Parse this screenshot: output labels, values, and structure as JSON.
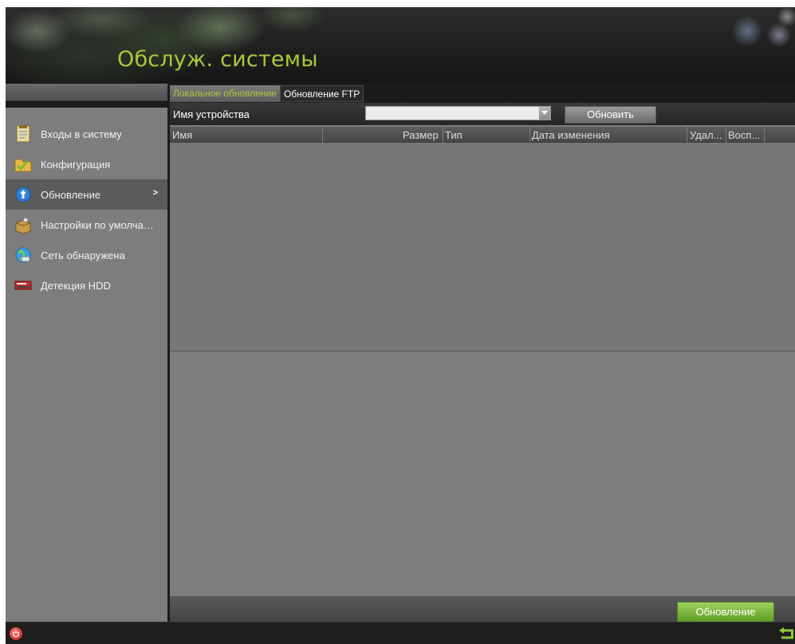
{
  "header": {
    "title": "Обслуж. системы"
  },
  "sidebar": {
    "items": [
      {
        "label": "Входы в систему",
        "icon": "log-document-icon",
        "active": false
      },
      {
        "label": "Конфигурация",
        "icon": "config-folder-icon",
        "active": false
      },
      {
        "label": "Обновление",
        "icon": "upgrade-arrow-icon",
        "active": true,
        "arrow": ">"
      },
      {
        "label": "Настройки по умолчан...",
        "icon": "default-box-icon",
        "active": false
      },
      {
        "label": "Сеть обнаружена",
        "icon": "network-globe-icon",
        "active": false
      },
      {
        "label": "Детекция HDD",
        "icon": "hdd-icon",
        "active": false
      }
    ]
  },
  "tabs": [
    {
      "label": "Локальное обновление",
      "active": true
    },
    {
      "label": "Обновление FTP",
      "active": false
    }
  ],
  "device": {
    "label": "Имя устройства",
    "selected_value": "",
    "refresh_label": "Обновить"
  },
  "table": {
    "columns": [
      "Имя",
      "Размер",
      "Тип",
      "Дата изменения",
      "Удал...",
      "Восп..."
    ],
    "rows": []
  },
  "footer": {
    "upgrade_label": "Обновление"
  },
  "colors": {
    "accent_green": "#a8c93a",
    "button_green": "#7cba3d",
    "panel_gray": "#7d7d7d",
    "power_red": "#d22a2a"
  }
}
